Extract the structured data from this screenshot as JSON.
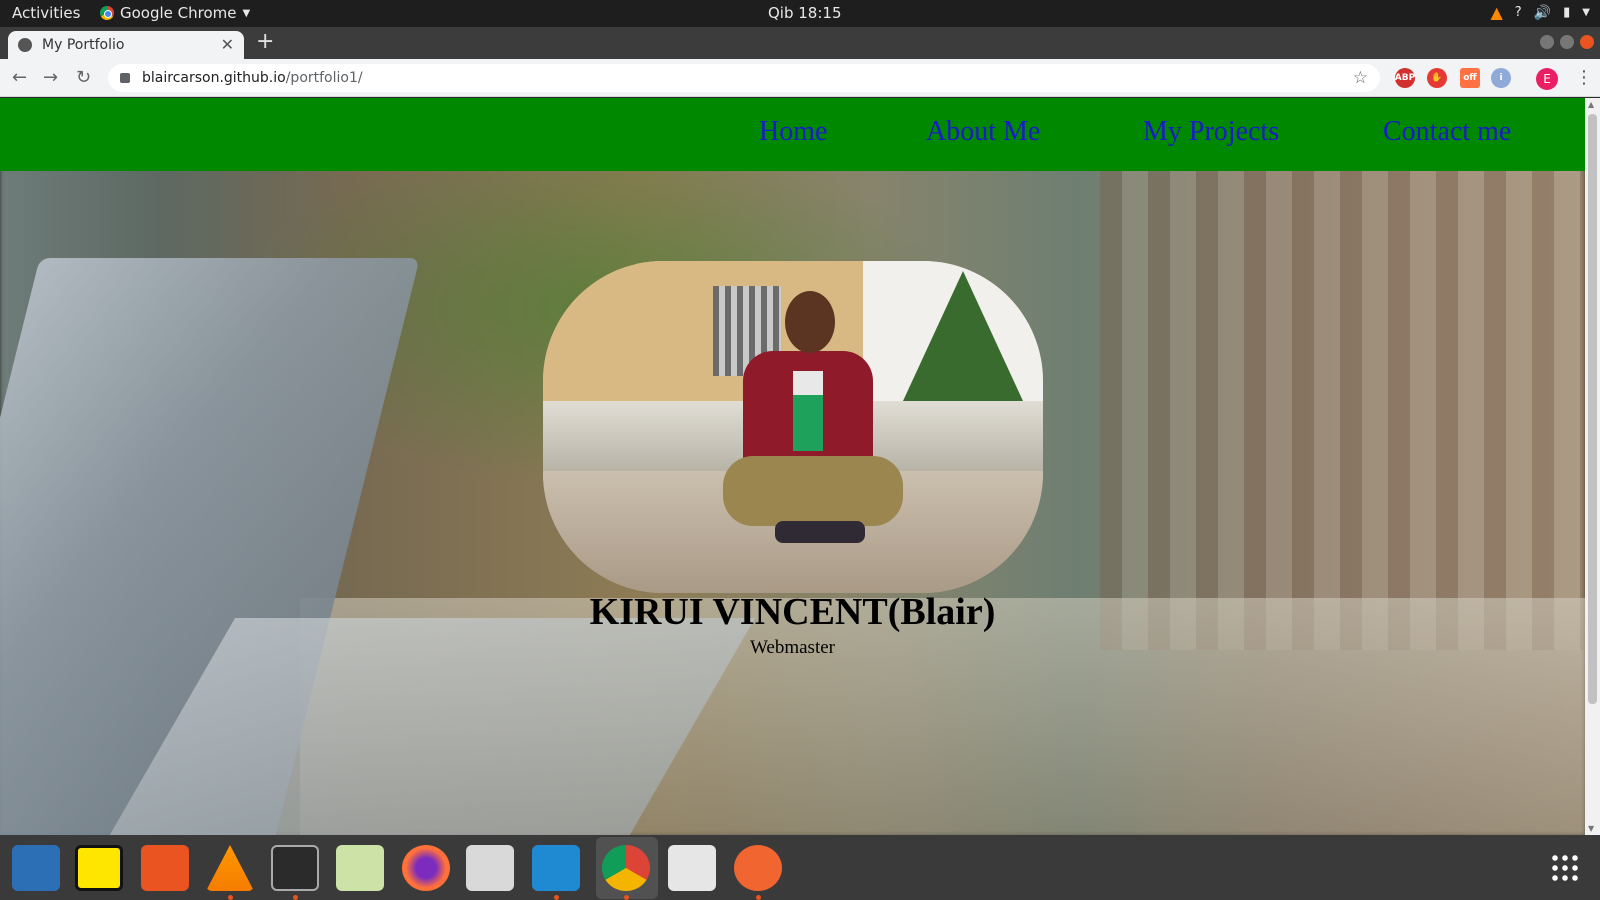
{
  "system_bar": {
    "activities": "Activities",
    "app_name": "Google Chrome",
    "clock": "Qib 18:15"
  },
  "browser": {
    "tab_title": "My Portfolio",
    "url_host": "blaircarson.github.io",
    "url_path": "/portfolio1/",
    "avatar_letter": "E",
    "extensions": [
      "ABP",
      "off"
    ]
  },
  "site": {
    "nav": {
      "home": "Home",
      "about": "About Me",
      "projects": "My Projects",
      "contact": "Contact me"
    },
    "name": "KIRUI VINCENT(Blair)",
    "role": "Webmaster"
  },
  "dock": {
    "apps": [
      "libreoffice-writer-icon",
      "notes-icon",
      "software-center-icon",
      "vlc-icon",
      "terminal-icon",
      "text-editor-icon",
      "firefox-icon",
      "files-icon",
      "vscode-icon",
      "chrome-icon",
      "image-viewer-icon",
      "inkscape-icon"
    ]
  }
}
